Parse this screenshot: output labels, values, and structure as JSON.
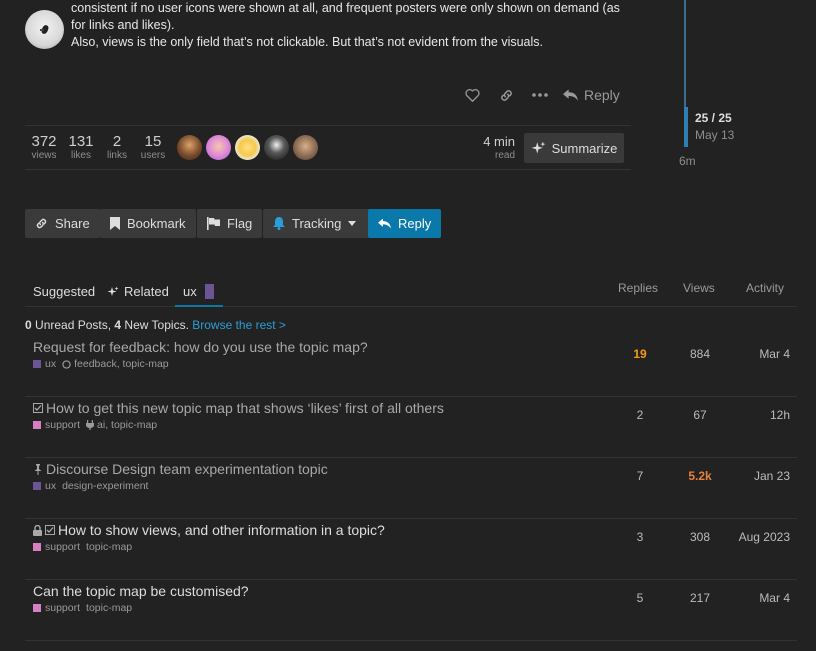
{
  "post": {
    "line1": "consistent if no user icons were shown at all, and frequent posters were only shown on demand (as",
    "line2": "for links and likes).",
    "line3": "Also, views is the only field that’s not clickable. But that’s not evident from the visuals.",
    "reply_label": "Reply"
  },
  "stats": {
    "views": {
      "num": "372",
      "lbl": "views"
    },
    "likes": {
      "num": "131",
      "lbl": "likes"
    },
    "links": {
      "num": "2",
      "lbl": "links"
    },
    "users": {
      "num": "15",
      "lbl": "users"
    },
    "read_time": {
      "num": "4 min",
      "lbl": "read"
    },
    "summarize": "Summarize"
  },
  "timeline": {
    "count": "25 / 25",
    "date": "May 13",
    "ago": "6m"
  },
  "footer": {
    "share": "Share",
    "bookmark": "Bookmark",
    "flag": "Flag",
    "tracking": "Tracking",
    "reply": "Reply"
  },
  "suggested": {
    "tab_suggested": "Suggested",
    "tab_related": "Related",
    "tab_ux": "ux",
    "col_replies": "Replies",
    "col_views": "Views",
    "col_activity": "Activity",
    "unread_count": "0",
    "unread_text": " Unread Posts, ",
    "new_count": "4",
    "new_text": " New Topics. ",
    "browse": "Browse the rest >"
  },
  "topics": [
    {
      "title": "Request for feedback: how do you use the topic map?",
      "category": "ux",
      "tags": "feedback, topic-map",
      "replies": "19",
      "views": "884",
      "activity": "Mar 4"
    },
    {
      "title": "How to get this new topic map that shows ‘likes’ first of all others",
      "category": "support",
      "tags": "ai, topic-map",
      "replies": "2",
      "views": "67",
      "activity": "12h"
    },
    {
      "title": "Discourse Design team experimentation topic",
      "category": "ux",
      "tags": "design-experiment",
      "replies": "7",
      "views": "5.2k",
      "activity": "Jan 23"
    },
    {
      "title": "How to show views, and other information in a topic?",
      "category": "support",
      "tags": "topic-map",
      "replies": "3",
      "views": "308",
      "activity": "Aug 2023"
    },
    {
      "title": "Can the topic map be customised?",
      "category": "support",
      "tags": "topic-map",
      "replies": "5",
      "views": "217",
      "activity": "Mar 4"
    }
  ],
  "colors": {
    "accent": "#0a78a8",
    "ux_category": "#6b5594",
    "support_category": "#d77fc0",
    "hot": "#f39c12"
  }
}
